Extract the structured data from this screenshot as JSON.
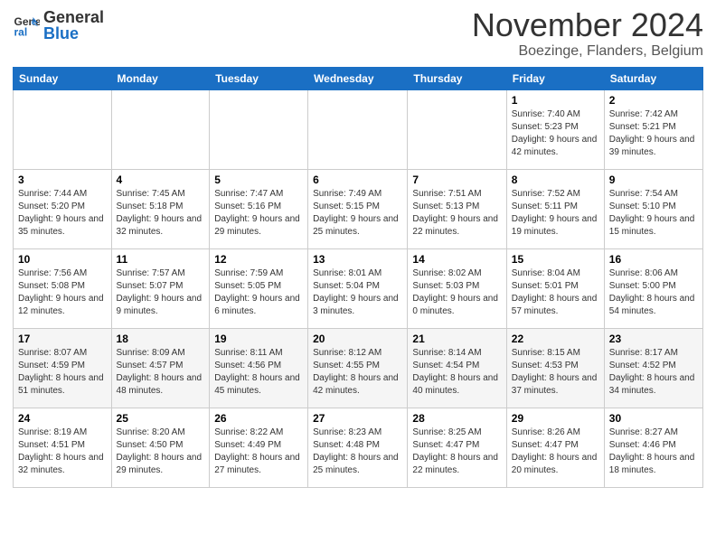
{
  "header": {
    "logo_line1": "General",
    "logo_line2": "Blue",
    "month_title": "November 2024",
    "location": "Boezinge, Flanders, Belgium"
  },
  "weekdays": [
    "Sunday",
    "Monday",
    "Tuesday",
    "Wednesday",
    "Thursday",
    "Friday",
    "Saturday"
  ],
  "weeks": [
    [
      {
        "day": "",
        "info": ""
      },
      {
        "day": "",
        "info": ""
      },
      {
        "day": "",
        "info": ""
      },
      {
        "day": "",
        "info": ""
      },
      {
        "day": "",
        "info": ""
      },
      {
        "day": "1",
        "info": "Sunrise: 7:40 AM\nSunset: 5:23 PM\nDaylight: 9 hours and 42 minutes."
      },
      {
        "day": "2",
        "info": "Sunrise: 7:42 AM\nSunset: 5:21 PM\nDaylight: 9 hours and 39 minutes."
      }
    ],
    [
      {
        "day": "3",
        "info": "Sunrise: 7:44 AM\nSunset: 5:20 PM\nDaylight: 9 hours and 35 minutes."
      },
      {
        "day": "4",
        "info": "Sunrise: 7:45 AM\nSunset: 5:18 PM\nDaylight: 9 hours and 32 minutes."
      },
      {
        "day": "5",
        "info": "Sunrise: 7:47 AM\nSunset: 5:16 PM\nDaylight: 9 hours and 29 minutes."
      },
      {
        "day": "6",
        "info": "Sunrise: 7:49 AM\nSunset: 5:15 PM\nDaylight: 9 hours and 25 minutes."
      },
      {
        "day": "7",
        "info": "Sunrise: 7:51 AM\nSunset: 5:13 PM\nDaylight: 9 hours and 22 minutes."
      },
      {
        "day": "8",
        "info": "Sunrise: 7:52 AM\nSunset: 5:11 PM\nDaylight: 9 hours and 19 minutes."
      },
      {
        "day": "9",
        "info": "Sunrise: 7:54 AM\nSunset: 5:10 PM\nDaylight: 9 hours and 15 minutes."
      }
    ],
    [
      {
        "day": "10",
        "info": "Sunrise: 7:56 AM\nSunset: 5:08 PM\nDaylight: 9 hours and 12 minutes."
      },
      {
        "day": "11",
        "info": "Sunrise: 7:57 AM\nSunset: 5:07 PM\nDaylight: 9 hours and 9 minutes."
      },
      {
        "day": "12",
        "info": "Sunrise: 7:59 AM\nSunset: 5:05 PM\nDaylight: 9 hours and 6 minutes."
      },
      {
        "day": "13",
        "info": "Sunrise: 8:01 AM\nSunset: 5:04 PM\nDaylight: 9 hours and 3 minutes."
      },
      {
        "day": "14",
        "info": "Sunrise: 8:02 AM\nSunset: 5:03 PM\nDaylight: 9 hours and 0 minutes."
      },
      {
        "day": "15",
        "info": "Sunrise: 8:04 AM\nSunset: 5:01 PM\nDaylight: 8 hours and 57 minutes."
      },
      {
        "day": "16",
        "info": "Sunrise: 8:06 AM\nSunset: 5:00 PM\nDaylight: 8 hours and 54 minutes."
      }
    ],
    [
      {
        "day": "17",
        "info": "Sunrise: 8:07 AM\nSunset: 4:59 PM\nDaylight: 8 hours and 51 minutes."
      },
      {
        "day": "18",
        "info": "Sunrise: 8:09 AM\nSunset: 4:57 PM\nDaylight: 8 hours and 48 minutes."
      },
      {
        "day": "19",
        "info": "Sunrise: 8:11 AM\nSunset: 4:56 PM\nDaylight: 8 hours and 45 minutes."
      },
      {
        "day": "20",
        "info": "Sunrise: 8:12 AM\nSunset: 4:55 PM\nDaylight: 8 hours and 42 minutes."
      },
      {
        "day": "21",
        "info": "Sunrise: 8:14 AM\nSunset: 4:54 PM\nDaylight: 8 hours and 40 minutes."
      },
      {
        "day": "22",
        "info": "Sunrise: 8:15 AM\nSunset: 4:53 PM\nDaylight: 8 hours and 37 minutes."
      },
      {
        "day": "23",
        "info": "Sunrise: 8:17 AM\nSunset: 4:52 PM\nDaylight: 8 hours and 34 minutes."
      }
    ],
    [
      {
        "day": "24",
        "info": "Sunrise: 8:19 AM\nSunset: 4:51 PM\nDaylight: 8 hours and 32 minutes."
      },
      {
        "day": "25",
        "info": "Sunrise: 8:20 AM\nSunset: 4:50 PM\nDaylight: 8 hours and 29 minutes."
      },
      {
        "day": "26",
        "info": "Sunrise: 8:22 AM\nSunset: 4:49 PM\nDaylight: 8 hours and 27 minutes."
      },
      {
        "day": "27",
        "info": "Sunrise: 8:23 AM\nSunset: 4:48 PM\nDaylight: 8 hours and 25 minutes."
      },
      {
        "day": "28",
        "info": "Sunrise: 8:25 AM\nSunset: 4:47 PM\nDaylight: 8 hours and 22 minutes."
      },
      {
        "day": "29",
        "info": "Sunrise: 8:26 AM\nSunset: 4:47 PM\nDaylight: 8 hours and 20 minutes."
      },
      {
        "day": "30",
        "info": "Sunrise: 8:27 AM\nSunset: 4:46 PM\nDaylight: 8 hours and 18 minutes."
      }
    ]
  ]
}
